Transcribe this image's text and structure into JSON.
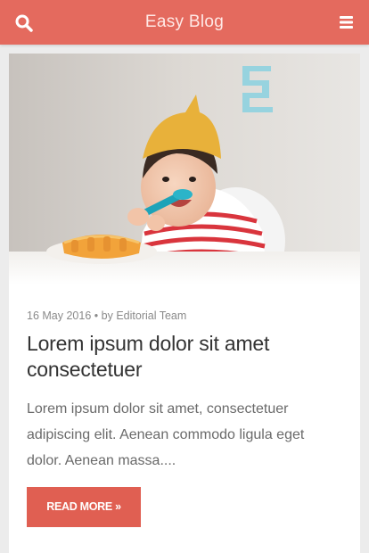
{
  "header": {
    "title": "Easy Blog",
    "search_icon": "search-icon",
    "menu_icon": "hamburger-menu-icon",
    "bar_color": "#e46a5e"
  },
  "post": {
    "image_alt": "Smiling toddler wearing a yellow paper crown holding a blue spoon",
    "date": "16 May 2016",
    "separator": "•",
    "by_label": "by",
    "author": "Editorial Team",
    "title": "Lorem ipsum dolor sit amet consectetuer",
    "excerpt": "Lorem ipsum dolor sit amet, consectetuer adipiscing elit. Aenean commodo ligula eget dolor. Aenean massa....",
    "read_more_label": "READ MORE »",
    "button_color": "#e05f52"
  }
}
